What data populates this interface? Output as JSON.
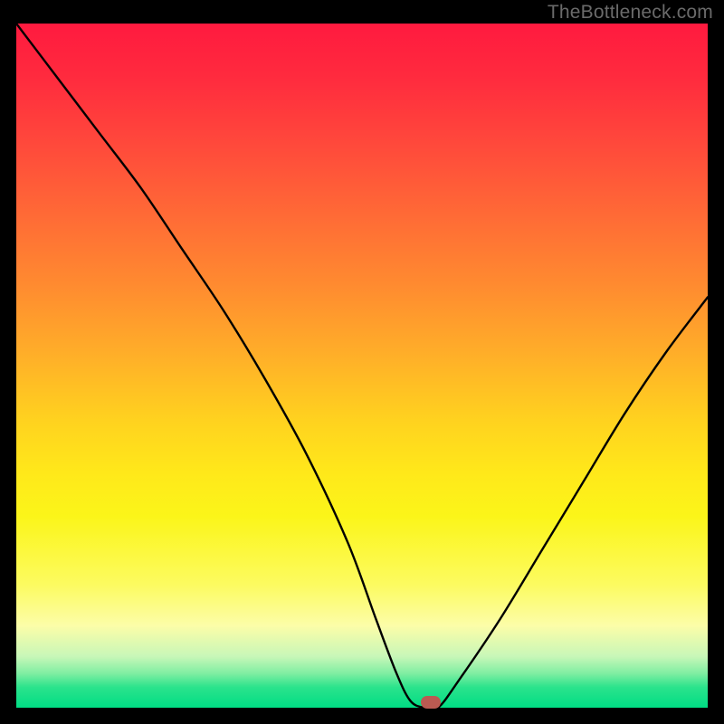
{
  "watermark": "TheBottleneck.com",
  "chart_data": {
    "type": "line",
    "title": "",
    "xlabel": "",
    "ylabel": "",
    "xlim": [
      0,
      100
    ],
    "ylim": [
      0,
      100
    ],
    "grid": false,
    "legend": false,
    "background_gradient": {
      "top": "#ff1a3f",
      "middle": "#ffd21f",
      "bottom": "#00dd84"
    },
    "series": [
      {
        "name": "bottleneck-curve",
        "color": "#000000",
        "x": [
          0,
          6,
          12,
          18,
          24,
          30,
          36,
          42,
          48,
          52,
          55,
          57,
          59,
          61,
          64,
          70,
          76,
          82,
          88,
          94,
          100
        ],
        "y": [
          100,
          92,
          84,
          76,
          67,
          58,
          48,
          37,
          24,
          13,
          5,
          1,
          0,
          0,
          4,
          13,
          23,
          33,
          43,
          52,
          60
        ]
      }
    ],
    "marker": {
      "name": "optimal-point",
      "color": "#bb5a52",
      "x": 60,
      "y": 0
    }
  }
}
